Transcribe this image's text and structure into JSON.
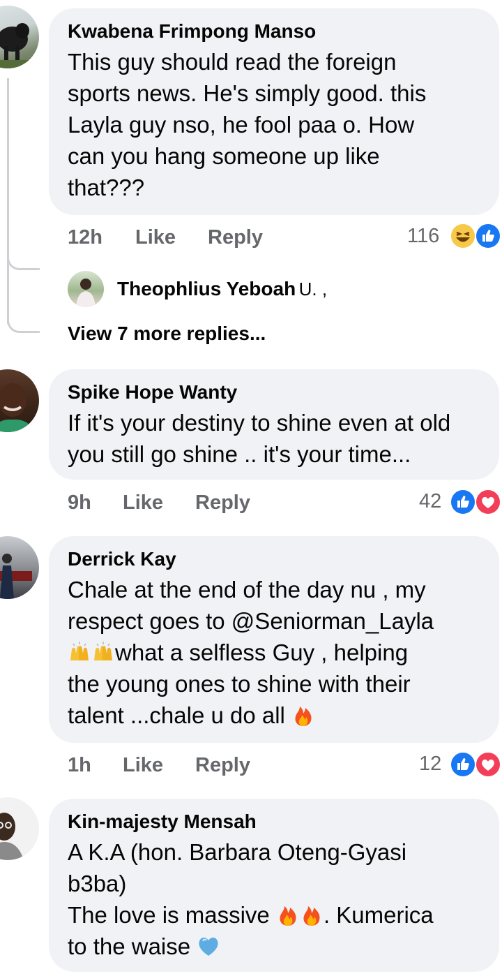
{
  "comments": [
    {
      "author": "Kwabena Frimpong Manso",
      "lines": [
        "This guy should read the foreign",
        "sports news. He's simply good. this",
        "Layla guy nso, he fool paa o. How",
        "can you hang someone up like",
        "that???"
      ],
      "time": "12h",
      "like_label": "Like",
      "reply_label": "Reply",
      "reaction_count": "116",
      "reactions": [
        "haha",
        "like"
      ]
    },
    {
      "author": "Spike Hope Wanty",
      "lines": [
        "If it's your destiny to shine even at old",
        "you still go shine .. it's your time..."
      ],
      "time": "9h",
      "like_label": "Like",
      "reply_label": "Reply",
      "reaction_count": "42",
      "reactions": [
        "like",
        "love"
      ]
    },
    {
      "author": "Derrick Kay",
      "lines": [
        "Chale at the end of the day nu , my",
        "respect goes to @Seniorman_Layla",
        "what a selfless Guy , helping",
        "the young ones to shine with their",
        "talent ...chale u do all"
      ],
      "time": "1h",
      "like_label": "Like",
      "reply_label": "Reply",
      "reaction_count": "12",
      "reactions": [
        "like",
        "love"
      ]
    },
    {
      "author": "Kin-majesty Mensah",
      "lines": [
        "A K.A (hon. Barbara Oteng-Gyasi",
        "b3ba)",
        "The love is massive",
        ". Kumerica",
        "to the waise"
      ]
    }
  ],
  "reply_preview": {
    "name": "Theophlius Yeboah",
    "snippet": "U. ,"
  },
  "view_more": "View 7 more replies...",
  "colors": {
    "bubble": "#f0f2f5",
    "meta_text": "#65676b",
    "like_blue": "#1877f2",
    "love_red": "#f33e58",
    "thread_line": "#ced0d4"
  }
}
